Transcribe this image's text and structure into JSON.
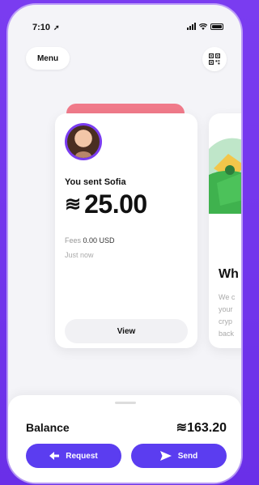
{
  "status_bar": {
    "time": "7:10",
    "location_icon": "navigation-arrow"
  },
  "header": {
    "menu_label": "Menu",
    "qr_icon": "qr-code-icon"
  },
  "card": {
    "accent_color": "#f07a8a",
    "sent_label": "You sent Sofia",
    "currency_symbol": "≋",
    "amount": "25.00",
    "fees_label": "Fees",
    "fees_value": "0.00 USD",
    "time_text": "Just now",
    "view_label": "View"
  },
  "next_card": {
    "title": "Wh",
    "lines": [
      "We c",
      "your",
      "cryp",
      "back"
    ]
  },
  "balance": {
    "label": "Balance",
    "value": "≋163.20"
  },
  "actions": {
    "request_label": "Request",
    "send_label": "Send",
    "color": "#5b3df0"
  }
}
